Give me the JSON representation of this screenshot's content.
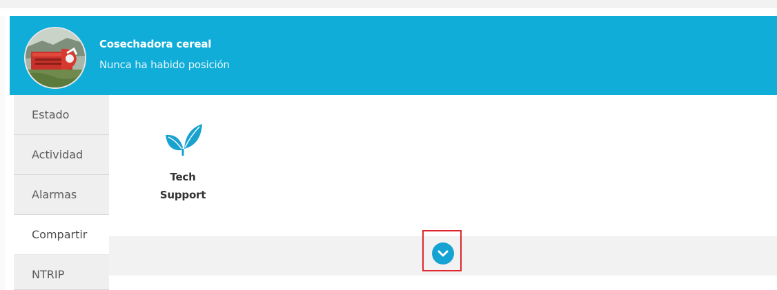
{
  "header": {
    "machine_name": "Cosechadora cereal",
    "status": "Nunca ha habido posición",
    "background_color": "#0fadd8"
  },
  "sidebar": {
    "tabs": [
      {
        "label": "Estado",
        "active": false
      },
      {
        "label": "Actividad",
        "active": false
      },
      {
        "label": "Alarmas",
        "active": false
      },
      {
        "label": "Compartir",
        "active": true
      },
      {
        "label": "NTRIP",
        "active": false
      }
    ]
  },
  "share": {
    "items": [
      {
        "label_line1": "Tech",
        "label_line2": "Support",
        "icon": "leaf-icon"
      }
    ]
  },
  "expand": {
    "icon": "chevron-down-icon",
    "accent_color": "#14a3d3",
    "highlight_color": "#e0262f"
  }
}
